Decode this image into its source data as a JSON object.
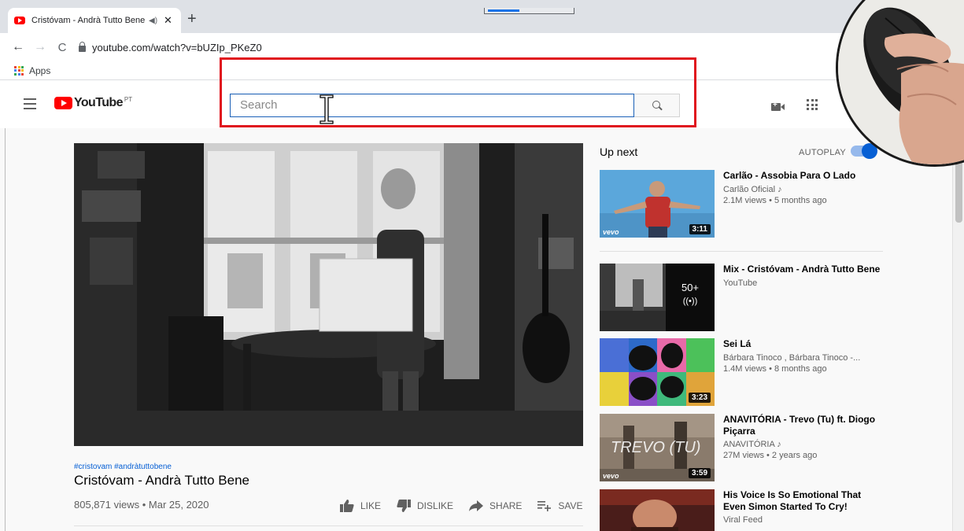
{
  "browser": {
    "tab_title": "Cristóvam - Andrà Tutto Bene",
    "tab_audio": "◀)",
    "tab_close": "✕",
    "new_tab": "+",
    "url": "youtube.com/watch?v=bUZIp_PKeZ0",
    "bookmarks": [
      {
        "label": "Apps"
      }
    ]
  },
  "masthead": {
    "logo_text": "YouTube",
    "region": "PT",
    "search_placeholder": "Search"
  },
  "video": {
    "hashtags": "#cristovam #andràtuttobene",
    "title": "Cristóvam - Andrà Tutto Bene",
    "views_date": "805,871 views • Mar 25, 2020",
    "actions": {
      "like": "LIKE",
      "dislike": "DISLIKE",
      "share": "SHARE",
      "save": "SAVE",
      "more": "..."
    }
  },
  "sidebar": {
    "up_next": "Up next",
    "autoplay": "AUTOPLAY",
    "autoplay_on": true,
    "items": [
      {
        "title": "Carlão - Assobia Para O Lado",
        "channel": "Carlão Oficial ♪",
        "meta": "2.1M views • 5 months ago",
        "duration": "3:11",
        "badge": "vevo"
      },
      {
        "title": "Mix - Cristóvam - Andrà Tutto Bene",
        "channel": "YouTube",
        "meta": "",
        "count": "50+",
        "mix_icon": "((•))"
      },
      {
        "title": "Sei Lá",
        "channel": "Bárbara Tinoco , Bárbara Tinoco -...",
        "meta": "1.4M views • 8 months ago",
        "duration": "3:23"
      },
      {
        "title": "ANAVITÓRIA - Trevo (Tu) ft. Diogo Piçarra",
        "channel": "ANAVITÓRIA ♪",
        "meta": "27M views • 2 years ago",
        "duration": "3:59",
        "badge": "vevo",
        "thumb_text": "TREVO (TU)"
      },
      {
        "title": "His Voice Is So Emotional That Even Simon Started To Cry!",
        "channel": "Viral Feed",
        "meta": ""
      }
    ]
  },
  "colors": {
    "youtube_red": "#ff0000",
    "highlight_red": "#e0141e",
    "link_blue": "#065fd4",
    "search_focus_border": "#1c62b9"
  }
}
